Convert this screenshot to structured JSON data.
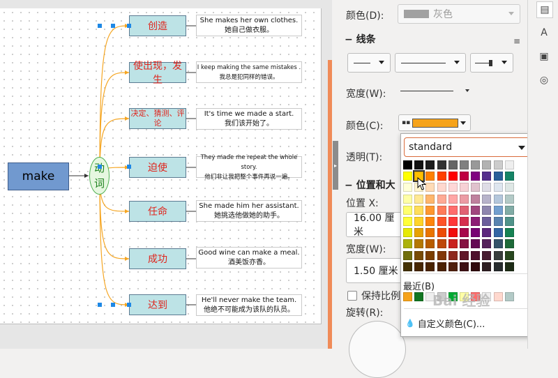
{
  "diagram": {
    "root": "make",
    "verb": [
      "动",
      "词"
    ],
    "branches": [
      {
        "word": "创造",
        "en": "She makes her own clothes.",
        "zh": "她自己做衣服。"
      },
      {
        "word": "使出现，发生",
        "en": "I keep making the same mistakes .",
        "zh": "我总是犯同样的错误。"
      },
      {
        "word": "决定、猜测、评论",
        "en": "It's time we made a start.",
        "zh": "我们该开始了。"
      },
      {
        "word": "迫使",
        "en": "They made me repeat the whole story.",
        "zh": "他们非让我把整个事件再说一遍。"
      },
      {
        "word": "任命",
        "en": "She made him her assistant.",
        "zh": "她挑选他做她的助手。"
      },
      {
        "word": "成功",
        "en": "Good wine can make a meal.",
        "zh": "酒美饭亦香。"
      },
      {
        "word": "达到",
        "en": "He'll never make the team.",
        "zh": "他绝不可能成为该队的队员。"
      }
    ]
  },
  "panel": {
    "fill_color_label": "颜色(D):",
    "fill_color_value": "灰色",
    "line_section": "线条",
    "width_label": "宽度(W):",
    "line_color_label": "颜色(C):",
    "transparency_label": "透明(T):",
    "position_section": "位置和大",
    "pos_x_label": "位置 X:",
    "pos_x_value": "16.00 厘米",
    "size_width_label": "宽度(W):",
    "size_width_value": "1.50 厘米",
    "keep_ratio_label": "保持比例",
    "rotation_label": "旋转(R):"
  },
  "color_popup": {
    "palette": "standard",
    "recent_label": "最近(B)",
    "custom_label": "自定义颜色(C)...",
    "selected_color": "#f6a31b"
  },
  "colors": {
    "orange_line": "#f5a623",
    "word_box": "#bde3e6",
    "root_box": "#7199cf",
    "verb_ellipse": "#e6f7e0"
  },
  "watermark": "Bai 经验"
}
